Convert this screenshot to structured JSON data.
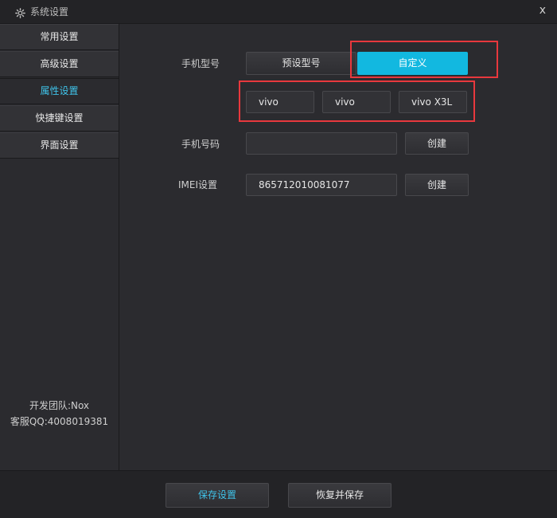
{
  "window": {
    "title": "系统设置",
    "close_label": "x"
  },
  "sidebar": {
    "items": [
      {
        "label": "常用设置",
        "active": false
      },
      {
        "label": "高级设置",
        "active": false
      },
      {
        "label": "属性设置",
        "active": true
      },
      {
        "label": "快捷键设置",
        "active": false
      },
      {
        "label": "界面设置",
        "active": false
      }
    ],
    "dev_team": "开发团队:Nox",
    "support_qq": "客服QQ:4008019381"
  },
  "main": {
    "phone_model": {
      "label": "手机型号",
      "preset_label": "预设型号",
      "custom_label": "自定义",
      "selected": "自定义",
      "brand": "vivo",
      "manufacturer": "vivo",
      "model": "vivo X3L"
    },
    "phone_number": {
      "label": "手机号码",
      "value": "",
      "create_label": "创建"
    },
    "imei": {
      "label": "IMEI设置",
      "value": "865712010081077",
      "create_label": "创建"
    }
  },
  "bottom": {
    "save_label": "保存设置",
    "restore_label": "恢复并保存"
  },
  "colors": {
    "accent": "#12b8e0",
    "active_text": "#3fc3ea",
    "highlight": "#e8383d",
    "background": "#2b2b2f"
  }
}
